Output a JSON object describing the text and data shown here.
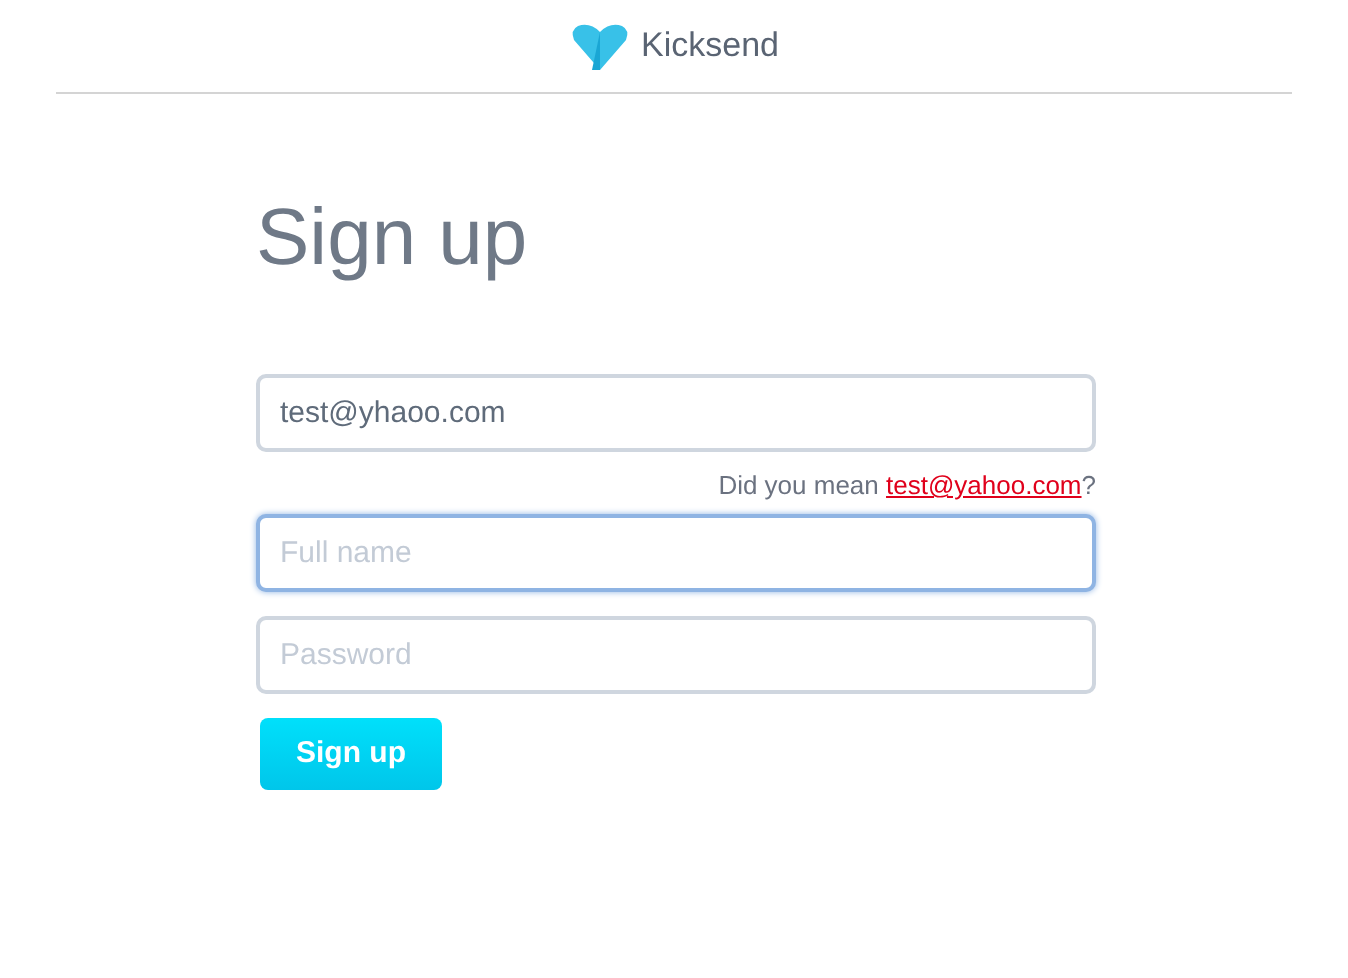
{
  "header": {
    "brand": "Kicksend"
  },
  "title": "Sign up",
  "fields": [
    {
      "kind": "email",
      "value": "test@yhaoo.com",
      "focused": false
    },
    {
      "kind": "suggestion",
      "prefix": "Did you mean ",
      "link": "test@yahoo.com",
      "suffix": "?"
    },
    {
      "kind": "text",
      "placeholder": "Full name",
      "focused": true
    },
    {
      "kind": "password",
      "placeholder": "Password",
      "focused": false
    }
  ],
  "submit": "Sign up"
}
